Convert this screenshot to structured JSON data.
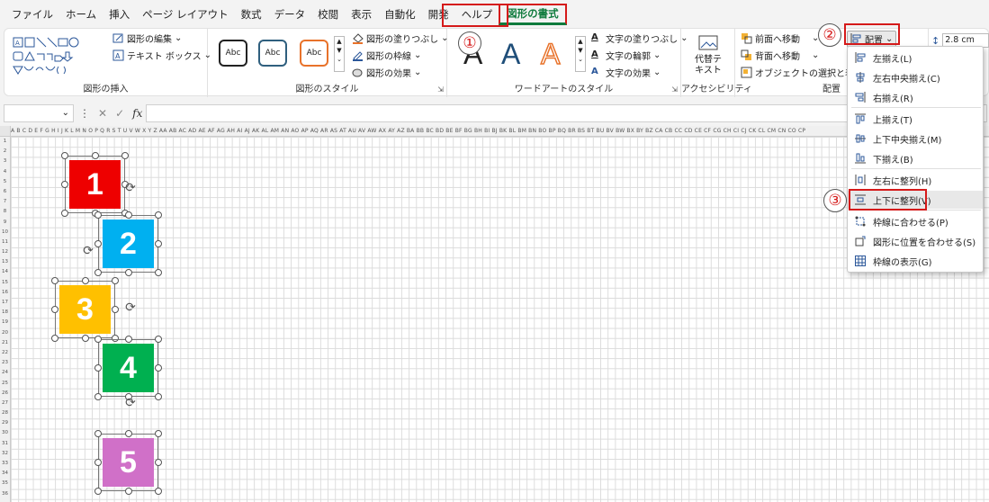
{
  "menubar": {
    "tabs": [
      "ファイル",
      "ホーム",
      "挿入",
      "ページ レイアウト",
      "数式",
      "データ",
      "校閲",
      "表示",
      "自動化",
      "開発",
      "ヘルプ",
      "図形の書式"
    ],
    "active_tab": "図形の書式"
  },
  "ribbon": {
    "insert_group": {
      "edit_shape": "図形の編集",
      "text_box": "テキスト ボックス",
      "label": "図形の挿入"
    },
    "style_group": {
      "abc": "Abc",
      "fill": "図形の塗りつぶし",
      "outline": "図形の枠線",
      "effect": "図形の効果",
      "label": "図形のスタイル"
    },
    "wordart_group": {
      "letter": "A",
      "text_fill": "文字の塗りつぶし",
      "text_outline": "文字の輪郭",
      "text_effect": "文字の効果",
      "label": "ワードアートのスタイル"
    },
    "access_group": {
      "alt_text_line1": "代替テ",
      "alt_text_line2": "キスト",
      "label": "アクセシビリティ"
    },
    "arrange_group": {
      "bring_forward": "前面へ移動",
      "send_backward": "背面へ移動",
      "selection_pane": "オブジェクトの選択と表示",
      "align": "配置",
      "label": "配置"
    },
    "size": {
      "height": "2.8 cm"
    }
  },
  "callouts": {
    "c1": "①",
    "c2": "②",
    "c3": "③"
  },
  "formula": {
    "fx": "fx"
  },
  "sheet": {
    "columns": "A B C D E F G H I J K L M N O P Q R S T U V W X Y Z AA AB AC AD AE AF AG AH AI AJ AK AL AM AN AO AP AQ AR AS AT AU AV AW AX AY AZ BA BB BC BD BE BF BG BH BI BJ BK BL BM BN BO BP BQ BR BS BT BU BV BW BX BY BZ CA CB CC CD CE CF CG CH CI CJ CK CL CM CN CO CP",
    "shapes": [
      {
        "label": "1",
        "color": "#ee0000"
      },
      {
        "label": "2",
        "color": "#00b0f0"
      },
      {
        "label": "3",
        "color": "#ffc000"
      },
      {
        "label": "4",
        "color": "#00b050"
      },
      {
        "label": "5",
        "color": "#d070c8"
      }
    ]
  },
  "align_menu": {
    "items": [
      {
        "label": "左揃え(L)",
        "icon": "align-left-icon"
      },
      {
        "label": "左右中央揃え(C)",
        "icon": "align-center-icon"
      },
      {
        "label": "右揃え(R)",
        "icon": "align-right-icon"
      },
      {
        "label": "上揃え(T)",
        "icon": "align-top-icon"
      },
      {
        "label": "上下中央揃え(M)",
        "icon": "align-middle-icon"
      },
      {
        "label": "下揃え(B)",
        "icon": "align-bottom-icon"
      },
      {
        "label": "左右に整列(H)",
        "icon": "distribute-horizontal-icon"
      },
      {
        "label": "上下に整列(V)",
        "icon": "distribute-vertical-icon"
      },
      {
        "label": "枠線に合わせる(P)",
        "icon": "snap-grid-icon"
      },
      {
        "label": "図形に位置を合わせる(S)",
        "icon": "snap-shape-icon"
      },
      {
        "label": "枠線の表示(G)",
        "icon": "view-gridlines-icon"
      }
    ],
    "highlighted_index": 7
  },
  "colors": {
    "accent_green": "#0f7b3d",
    "callout_red": "#d51a1a"
  }
}
